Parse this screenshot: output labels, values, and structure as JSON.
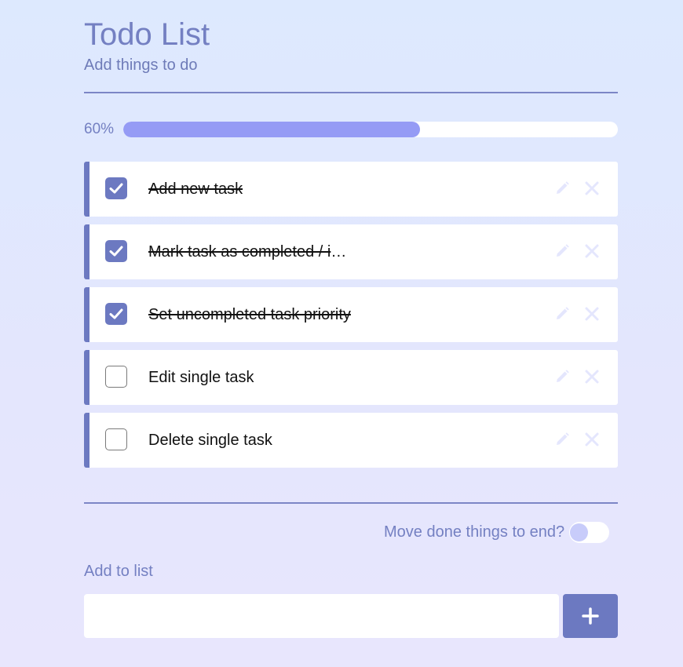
{
  "header": {
    "title": "Todo List",
    "subtitle": "Add things to do"
  },
  "progress": {
    "label": "60%",
    "value": 0.6
  },
  "tasks": [
    {
      "text": "Add new task",
      "done": true
    },
    {
      "text": "Mark task as completed / incomplete",
      "done": true
    },
    {
      "text": "Set uncompleted task priority",
      "done": true
    },
    {
      "text": "Edit single task",
      "done": false
    },
    {
      "text": "Delete single task",
      "done": false
    }
  ],
  "options": {
    "move_done_label": "Move done things to end?",
    "move_done_enabled": false
  },
  "add": {
    "label": "Add to list",
    "input_value": "",
    "button_icon": "plus-icon"
  },
  "icons": {
    "checkbox_checked": "check-icon",
    "edit": "pencil-icon",
    "delete": "close-icon"
  },
  "colors": {
    "accent": "#6c79c1",
    "progress_fill": "#959bf5",
    "text_heading": "#7480c2",
    "action_icons": "#e4e6fd"
  }
}
